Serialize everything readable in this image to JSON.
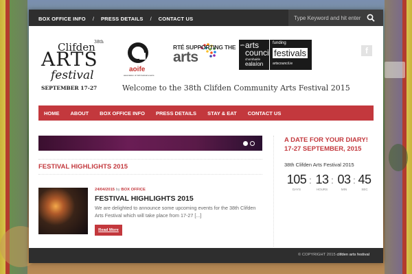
{
  "topnav": {
    "items": [
      "BOX OFFICE INFO",
      "PRESS DETAILS",
      "CONTACT US"
    ],
    "separator": "/"
  },
  "search": {
    "placeholder": "Type Keyword and hit enter"
  },
  "logo": {
    "clifden": "Clifden",
    "edition": "38th",
    "arts": "ARTS",
    "festival": "festival",
    "dates": "SEPTEMBER 17-27"
  },
  "sponsors": {
    "aoife": "aoife",
    "aoife_sub": "association of irish festival events",
    "rte_top": "RTÉ SUPPORTING THE",
    "rte_arts": "arts",
    "council_ga": "arts",
    "council_1": "arts",
    "council_2": "council",
    "council_3": "chomhairle",
    "council_4": "ealaíon",
    "funding": "funding",
    "festivals": "festivals",
    "council_url": "artscouncil.ie"
  },
  "social": {
    "facebook": "f"
  },
  "welcome": "Welcome to the 38th Clifden Community Arts Festival 2015",
  "mainnav": {
    "items": [
      "HOME",
      "ABOUT",
      "BOX OFFICE INFO",
      "PRESS DETAILS",
      "STAY & EAT",
      "CONTACT US"
    ]
  },
  "section": {
    "title": "FESTIVAL HIGHLIGHTS 2015"
  },
  "post": {
    "date": "24/04/2015",
    "by": "by",
    "category": "BOX OFFICE",
    "title": "FESTIVAL HIGHLIGHTS 2015",
    "excerpt": "We are delighted to announce some upcoming events for the 38th Clifden Arts Festival which will take place from 17-27 [...]",
    "read_more": "Read More"
  },
  "sidebar": {
    "diary_title": "A DATE FOR YOUR DIARY! 17-27 SEPTEMBER, 2015",
    "festival_line": "38th Clifden Arts Festival 2015",
    "countdown": {
      "days": "105",
      "hours": "13",
      "min": "03",
      "sec": "45",
      "days_label": "DAYS",
      "hours_label": "HOURS",
      "min_label": "MIN",
      "sec_label": "SEC"
    }
  },
  "footer": {
    "copyright": "© COPYRIGHT 2015",
    "site": "clifden arts festival"
  },
  "colors": {
    "accent": "#c3383d",
    "dark": "#2e2e2e"
  }
}
